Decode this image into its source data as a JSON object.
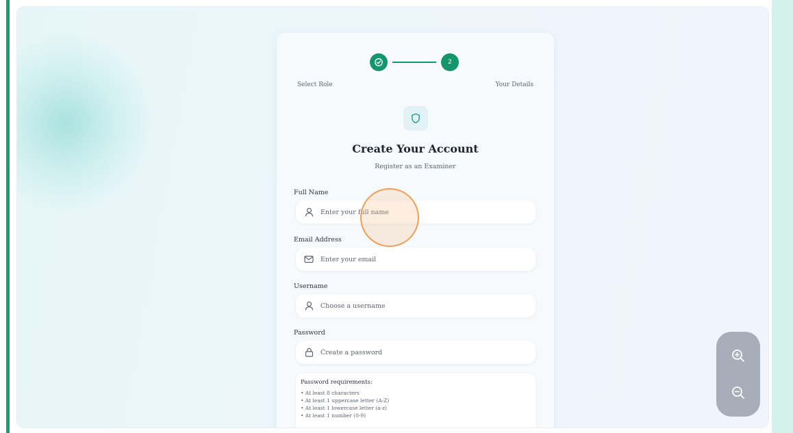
{
  "stepper": {
    "step1_label": "Select Role",
    "step2_label": "Your Details",
    "step2_number": "2"
  },
  "header": {
    "title": "Create Your Account",
    "subtitle": "Register as an Examiner"
  },
  "form": {
    "full_name": {
      "label": "Full Name",
      "placeholder": "Enter your full name",
      "icon": "user-icon"
    },
    "email": {
      "label": "Email Address",
      "placeholder": "Enter your email",
      "icon": "mail-icon"
    },
    "username": {
      "label": "Username",
      "placeholder": "Choose a username",
      "icon": "user-icon"
    },
    "password": {
      "label": "Password",
      "placeholder": "Create a password",
      "icon": "lock-icon"
    }
  },
  "password_requirements": {
    "title": "Password requirements:",
    "items": [
      "• At least 8 characters",
      "• At least 1 uppercase letter (A-Z)",
      "• At least 1 lowercase letter (a-z)",
      "• At least 1 number (0-9)"
    ]
  },
  "zoom": {
    "in_icon": "zoom-in-icon",
    "out_icon": "zoom-out-icon"
  },
  "colors": {
    "accent": "#15966a",
    "cursor_ring": "#ee9646",
    "zoom_panel": "#a8adba"
  }
}
